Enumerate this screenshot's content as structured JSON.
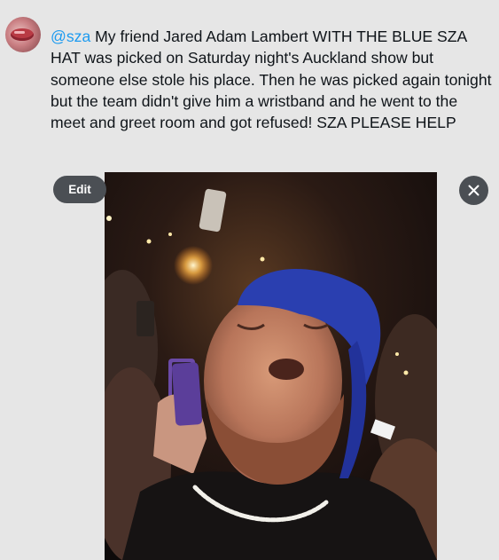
{
  "tweet": {
    "mention": "@sza",
    "body": " My friend Jared Adam Lambert WITH THE BLUE SZA HAT was picked on Saturday night's Auckland show but someone else stole his place. Then he was picked again tonight but the team didn't give him a wristband and he went to the meet and greet room and got refused! SZA PLEASE HELP"
  },
  "media": {
    "edit_label": "Edit",
    "close_icon": "close-icon",
    "image_alt": "Concert crowd photo of a man in a blue cap singing"
  },
  "colors": {
    "background": "#e6e6e6",
    "text": "#0f1419",
    "mention": "#1d9bf0",
    "button_bg": "#4b4f54",
    "cap_blue": "#2a3fb0"
  }
}
